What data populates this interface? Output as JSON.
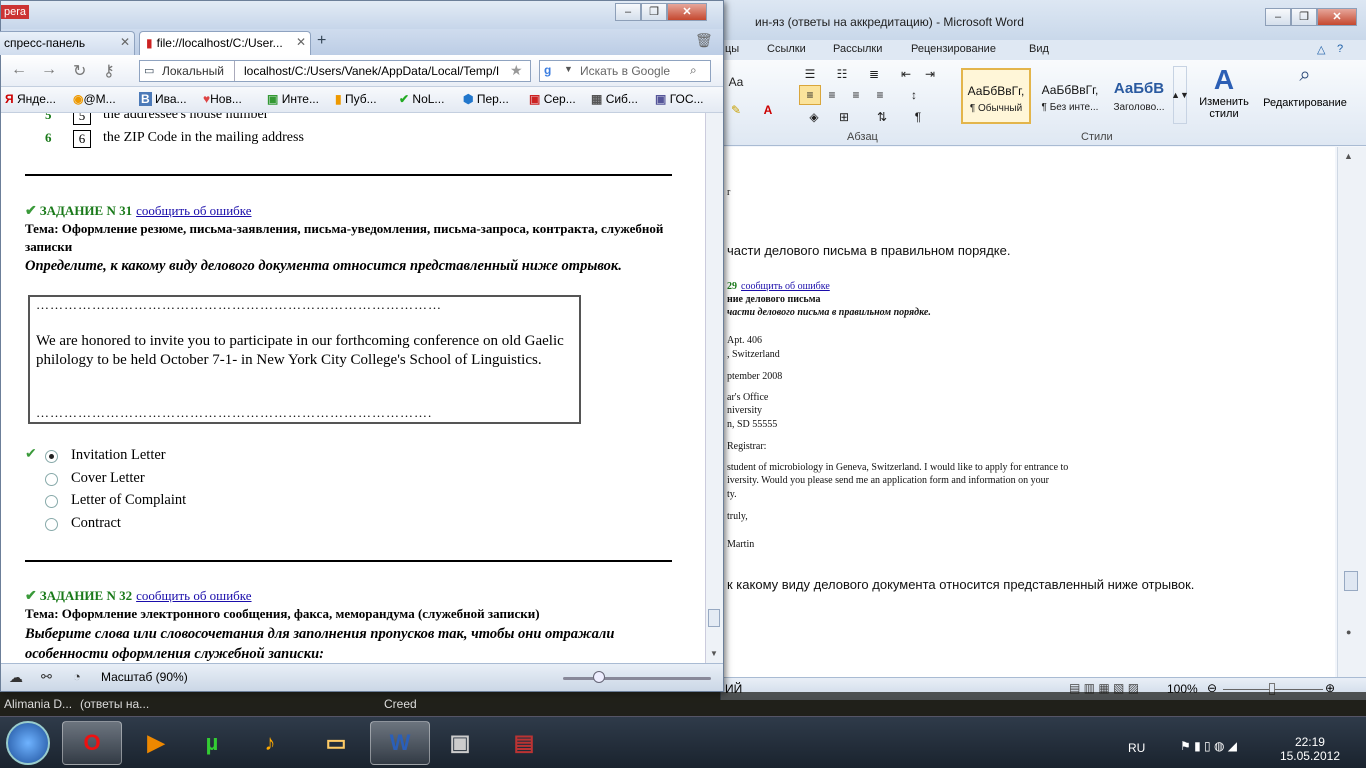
{
  "word": {
    "title": "ин-яз (ответы на аккредитацию)  -  Microsoft Word",
    "tabs": [
      "цы",
      "Ссылки",
      "Рассылки",
      "Рецензирование",
      "Вид"
    ],
    "groups": {
      "paragraph": "Абзац",
      "styles": "Стили"
    },
    "styles": [
      {
        "preview": "АаБбВвГг,",
        "name": "¶ Обычный"
      },
      {
        "preview": "АаБбВвГг,",
        "name": "¶ Без инте..."
      },
      {
        "preview": "АаБбВ",
        "name": "Заголово..."
      }
    ],
    "change_styles": "Изменить стили",
    "editing": "Редактирование",
    "doc_lines": [
      "r",
      "части делового письма в правильном порядке.",
      "29",
      "сообщить об ошибке",
      "ние делового письма",
      "части делового письма в правильном порядке.",
      "Apt. 406",
      ", Switzerland",
      "ptember 2008",
      "ar's Office",
      "niversity",
      "n, SD 55555",
      "Registrar:",
      "student of microbiology in Geneva, Switzerland. I would like to apply for entrance to",
      "iversity. Would you please send me an application form and information on your",
      "ty.",
      "truly,",
      "Martin",
      "к какому виду делового документа относится представленный ниже отрывок."
    ],
    "status": {
      "left": "ИЙ",
      "zoom": "100%"
    }
  },
  "opera": {
    "title_logo": "pera",
    "tabs": [
      {
        "label": "спресс-панель"
      },
      {
        "label": "file://localhost/C:/User..."
      }
    ],
    "address": {
      "badge": "Локальный",
      "url": "localhost/C:/Users/Vanek/AppData/Local/Temp/I"
    },
    "search": {
      "placeholder": "Искать в Google"
    },
    "bookmarks": [
      "Янде...",
      "@M...",
      "Ива...",
      "Нов...",
      "Инте...",
      "Пуб...",
      "NoL...",
      "Пер...",
      "Сер...",
      "Сиб...",
      "ГОС..."
    ],
    "status": {
      "zoom": "Масштаб (90%)"
    }
  },
  "content": {
    "prev_rows": [
      {
        "num": "5",
        "box": "5",
        "text": "the addressee's house number"
      },
      {
        "num": "6",
        "box": "6",
        "text": "the ZIP Code in the mailing address"
      }
    ],
    "task31": {
      "title": "ЗАДАНИЕ N 31",
      "report": "сообщить об ошибке",
      "topic": "Тема: Оформление резюме, письма-заявления, письма-уведомления, письма-запроса, контракта, служебной записки",
      "instruction": "Определите, к какому виду делового документа относится представленный ниже отрывок.",
      "dots_top": "……………………………………………………………………………",
      "excerpt": "We are honored to invite you to participate in our forthcoming conference on old Gaelic philology to be held October 7-1- in New York City College's School of Linguistics.",
      "dots_bottom": "………………………………………………………………………….",
      "answers": [
        {
          "label": "Invitation Letter",
          "selected": true
        },
        {
          "label": "Cover Letter",
          "selected": false
        },
        {
          "label": "Letter of Complaint",
          "selected": false
        },
        {
          "label": "Contract",
          "selected": false
        }
      ]
    },
    "task32": {
      "title": "ЗАДАНИЕ N 32",
      "report": "сообщить об ошибке",
      "topic": "Тема: Оформление электронного сообщения, факса, меморандума (служебной записки)",
      "instruction": "Выберите слова или словосочетания для заполнения пропусков так, чтобы они отражали особенности оформления служебной записки:"
    }
  },
  "taskbar": {
    "strip": [
      "Alimania D...",
      "(ответы на...",
      "Creed"
    ],
    "lang": "RU",
    "time": "22:19",
    "date": "15.05.2012"
  }
}
